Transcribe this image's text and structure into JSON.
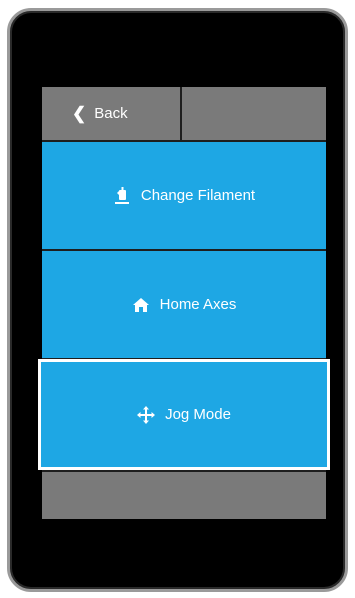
{
  "header": {
    "back_label": "Back"
  },
  "menu": {
    "items": [
      {
        "label": "Change Filament",
        "icon": "filament-icon"
      },
      {
        "label": "Home Axes",
        "icon": "home-icon"
      },
      {
        "label": "Jog Mode",
        "icon": "move-arrows-icon",
        "selected": true
      }
    ]
  },
  "colors": {
    "bezel": "#000000",
    "button_blue": "#1ea7e4",
    "bar_gray": "#7a7a7a",
    "selected_border": "#ffffff"
  }
}
